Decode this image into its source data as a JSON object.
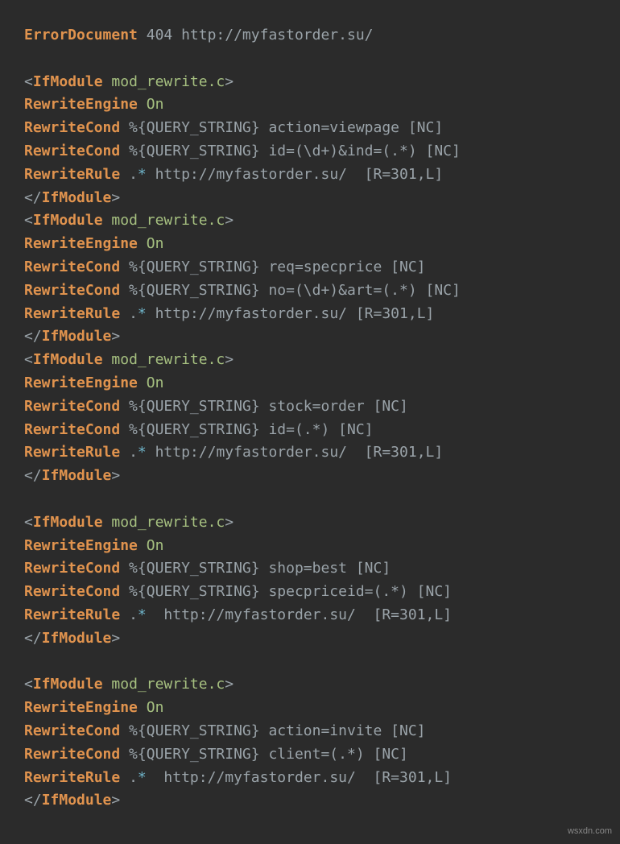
{
  "watermark": "wsxdn.com",
  "lines": [
    [
      [
        "dir",
        "ErrorDocument"
      ],
      [
        "txt",
        " 404 http://myfastorder.su/"
      ]
    ],
    [
      [
        "txt",
        ""
      ]
    ],
    [
      [
        "ang",
        "<"
      ],
      [
        "dir",
        "IfModule"
      ],
      [
        "txt",
        " "
      ],
      [
        "str",
        "mod_rewrite.c"
      ],
      [
        "ang",
        ">"
      ]
    ],
    [
      [
        "dir",
        "RewriteEngine"
      ],
      [
        "txt",
        " "
      ],
      [
        "str",
        "On"
      ]
    ],
    [
      [
        "dir",
        "RewriteCond"
      ],
      [
        "txt",
        " %{QUERY_STRING} action=viewpage [NC]"
      ]
    ],
    [
      [
        "dir",
        "RewriteCond"
      ],
      [
        "txt",
        " %{QUERY_STRING} id=(\\d+)&ind=(.*) [NC]"
      ]
    ],
    [
      [
        "dir",
        "RewriteRule"
      ],
      [
        "txt",
        " "
      ],
      [
        "wild",
        "."
      ],
      [
        "star",
        "*"
      ],
      [
        "txt",
        " http://myfastorder.su/  [R=301,L]"
      ]
    ],
    [
      [
        "ang",
        "</"
      ],
      [
        "dir",
        "IfModule"
      ],
      [
        "ang",
        ">"
      ]
    ],
    [
      [
        "ang",
        "<"
      ],
      [
        "dir",
        "IfModule"
      ],
      [
        "txt",
        " "
      ],
      [
        "str",
        "mod_rewrite.c"
      ],
      [
        "ang",
        ">"
      ]
    ],
    [
      [
        "dir",
        "RewriteEngine"
      ],
      [
        "txt",
        " "
      ],
      [
        "str",
        "On"
      ]
    ],
    [
      [
        "dir",
        "RewriteCond"
      ],
      [
        "txt",
        " %{QUERY_STRING} req=specprice [NC]"
      ]
    ],
    [
      [
        "dir",
        "RewriteCond"
      ],
      [
        "txt",
        " %{QUERY_STRING} no=(\\d+)&art=(.*) [NC]"
      ]
    ],
    [
      [
        "dir",
        "RewriteRule"
      ],
      [
        "txt",
        " "
      ],
      [
        "wild",
        "."
      ],
      [
        "star",
        "*"
      ],
      [
        "txt",
        " http://myfastorder.su/ [R=301,L]"
      ]
    ],
    [
      [
        "ang",
        "</"
      ],
      [
        "dir",
        "IfModule"
      ],
      [
        "ang",
        ">"
      ]
    ],
    [
      [
        "ang",
        "<"
      ],
      [
        "dir",
        "IfModule"
      ],
      [
        "txt",
        " "
      ],
      [
        "str",
        "mod_rewrite.c"
      ],
      [
        "ang",
        ">"
      ]
    ],
    [
      [
        "dir",
        "RewriteEngine"
      ],
      [
        "txt",
        " "
      ],
      [
        "str",
        "On"
      ]
    ],
    [
      [
        "dir",
        "RewriteCond"
      ],
      [
        "txt",
        " %{QUERY_STRING} stock=order [NC]"
      ]
    ],
    [
      [
        "dir",
        "RewriteCond"
      ],
      [
        "txt",
        " %{QUERY_STRING} id=(.*) [NC]"
      ]
    ],
    [
      [
        "dir",
        "RewriteRule"
      ],
      [
        "txt",
        " "
      ],
      [
        "wild",
        "."
      ],
      [
        "star",
        "*"
      ],
      [
        "txt",
        " http://myfastorder.su/  [R=301,L]"
      ]
    ],
    [
      [
        "ang",
        "</"
      ],
      [
        "dir",
        "IfModule"
      ],
      [
        "ang",
        ">"
      ]
    ],
    [
      [
        "txt",
        ""
      ]
    ],
    [
      [
        "ang",
        "<"
      ],
      [
        "dir",
        "IfModule"
      ],
      [
        "txt",
        " "
      ],
      [
        "str",
        "mod_rewrite.c"
      ],
      [
        "ang",
        ">"
      ]
    ],
    [
      [
        "dir",
        "RewriteEngine"
      ],
      [
        "txt",
        " "
      ],
      [
        "str",
        "On"
      ]
    ],
    [
      [
        "dir",
        "RewriteCond"
      ],
      [
        "txt",
        " %{QUERY_STRING} shop=best [NC]"
      ]
    ],
    [
      [
        "dir",
        "RewriteCond"
      ],
      [
        "txt",
        " %{QUERY_STRING} specpriceid=(.*) [NC]"
      ]
    ],
    [
      [
        "dir",
        "RewriteRule"
      ],
      [
        "txt",
        " "
      ],
      [
        "wild",
        "."
      ],
      [
        "star",
        "*"
      ],
      [
        "txt",
        "  http://myfastorder.su/  [R=301,L]"
      ]
    ],
    [
      [
        "ang",
        "</"
      ],
      [
        "dir",
        "IfModule"
      ],
      [
        "ang",
        ">"
      ]
    ],
    [
      [
        "txt",
        ""
      ]
    ],
    [
      [
        "ang",
        "<"
      ],
      [
        "dir",
        "IfModule"
      ],
      [
        "txt",
        " "
      ],
      [
        "str",
        "mod_rewrite.c"
      ],
      [
        "ang",
        ">"
      ]
    ],
    [
      [
        "dir",
        "RewriteEngine"
      ],
      [
        "txt",
        " "
      ],
      [
        "str",
        "On"
      ]
    ],
    [
      [
        "dir",
        "RewriteCond"
      ],
      [
        "txt",
        " %{QUERY_STRING} action=invite [NC]"
      ]
    ],
    [
      [
        "dir",
        "RewriteCond"
      ],
      [
        "txt",
        " %{QUERY_STRING} client=(.*) [NC]"
      ]
    ],
    [
      [
        "dir",
        "RewriteRule"
      ],
      [
        "txt",
        " "
      ],
      [
        "wild",
        "."
      ],
      [
        "star",
        "*"
      ],
      [
        "txt",
        "  http://myfastorder.su/  [R=301,L]"
      ]
    ],
    [
      [
        "ang",
        "</"
      ],
      [
        "dir",
        "IfModule"
      ],
      [
        "ang",
        ">"
      ]
    ]
  ]
}
